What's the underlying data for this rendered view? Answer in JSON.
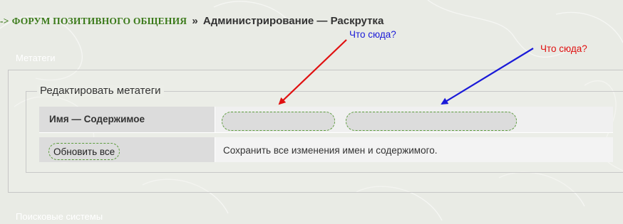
{
  "breadcrumb": {
    "prefix": "->",
    "forum_link": "ФОРУМ ПОЗИТИВНОГО ОБЩЕНИЯ",
    "separator": "»",
    "current": "Администрирование — Раскрутка"
  },
  "sections": {
    "metatags_header": "Метатеги",
    "search_engines_header": "Поисковые системы"
  },
  "form": {
    "legend": "Редактировать метатеги",
    "name_content_label": "Имя — Содержимое",
    "name_value": "",
    "content_value": "",
    "update_button": "Обновить все",
    "update_help": "Сохранить все изменения имен и содержимого."
  },
  "annotations": {
    "blue_note": "Что сюда?",
    "red_note": "Что сюда?"
  },
  "colors": {
    "link_green": "#3b7a1a",
    "input_border": "#5b9c3b",
    "annotation_red": "#e01010",
    "annotation_blue": "#1a1ad8"
  }
}
